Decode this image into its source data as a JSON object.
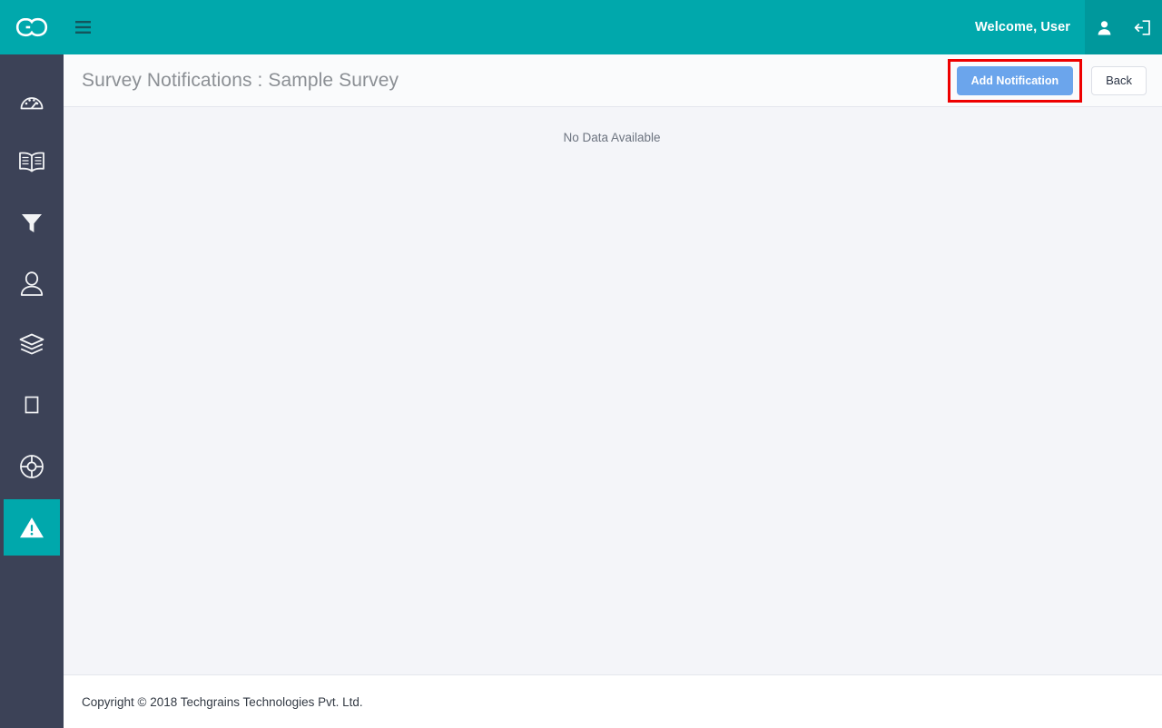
{
  "topbar": {
    "logo_icon": "go-logo-icon",
    "menu_toggle_icon": "hamburger-menu-icon",
    "welcome_text": "Welcome, User",
    "profile_icon": "user-profile-icon",
    "logout_icon": "logout-icon",
    "background_color": "#00a8ac",
    "actions_background_color": "#00989c"
  },
  "sidebar": {
    "background_color": "#3c4257",
    "active_background_color": "#00a8ac",
    "items": [
      {
        "icon": "dashboard-gauge-icon",
        "active": false
      },
      {
        "icon": "open-book-icon",
        "active": false
      },
      {
        "icon": "filter-funnel-icon",
        "active": false
      },
      {
        "icon": "user-icon",
        "active": false
      },
      {
        "icon": "layers-icon",
        "active": false
      },
      {
        "icon": "square-box-icon",
        "active": false
      },
      {
        "icon": "lifebuoy-support-icon",
        "active": false
      },
      {
        "icon": "warning-triangle-icon",
        "active": true
      }
    ]
  },
  "page": {
    "title": "Survey Notifications : Sample Survey",
    "add_button_label": "Add Notification",
    "add_button_color": "#6ba5ec",
    "highlight_color": "#ee0000",
    "back_button_label": "Back",
    "empty_state_text": "No Data Available",
    "content_background_color": "#f4f5f9"
  },
  "footer": {
    "copyright": "Copyright © 2018 Techgrains Technologies Pvt. Ltd."
  }
}
